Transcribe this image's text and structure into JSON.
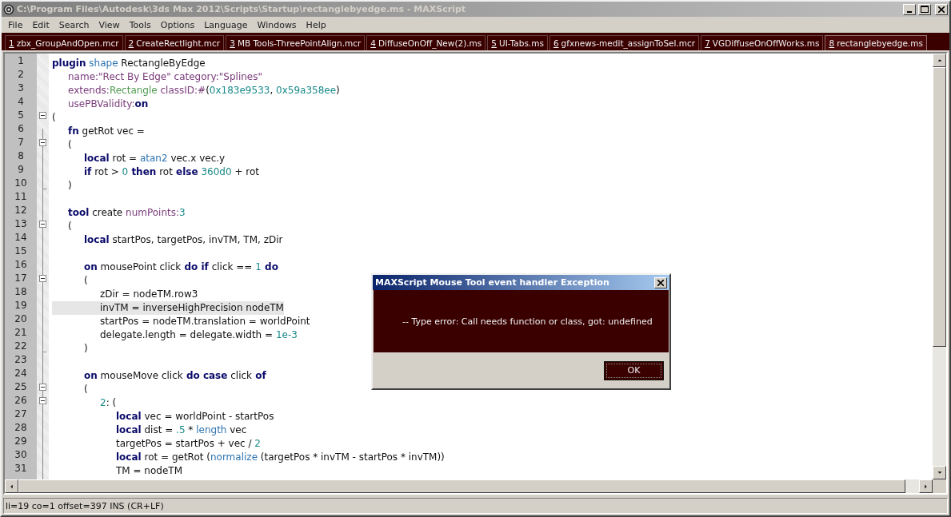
{
  "window": {
    "title": "C:\\Program Files\\Autodesk\\3ds Max 2012\\Scripts\\Startup\\rectanglebyedge.ms - MAXScript"
  },
  "menu": [
    "File",
    "Edit",
    "Search",
    "View",
    "Tools",
    "Options",
    "Language",
    "Windows",
    "Help"
  ],
  "tabs": [
    {
      "number": "1",
      "label": "zbx_GroupAndOpen.mcr",
      "selected": false
    },
    {
      "number": "2",
      "label": "CreateRectlight.mcr",
      "selected": false
    },
    {
      "number": "3",
      "label": "MB Tools-ThreePointAlign.mcr",
      "selected": false
    },
    {
      "number": "4",
      "label": "DiffuseOnOff_New(2).ms",
      "selected": false
    },
    {
      "number": "5",
      "label": "UI-Tabs.ms",
      "selected": false
    },
    {
      "number": "6",
      "label": "gfxnews-medit_assignToSel.mcr",
      "selected": false
    },
    {
      "number": "7",
      "label": "VGDiffuseOnOffWorks.ms",
      "selected": false
    },
    {
      "number": "8",
      "label": "rectanglebyedge.ms",
      "selected": true
    }
  ],
  "editor": {
    "lines": [
      {
        "number": "1",
        "tokens": [
          {
            "kind": "keyword",
            "text": "plugin"
          },
          {
            "kind": "function",
            "text": " shape"
          },
          {
            "kind": "plain",
            "text": " RectangleByEdge"
          }
        ]
      },
      {
        "number": "2",
        "tokens": [
          {
            "kind": "param",
            "text": "\tname:"
          },
          {
            "kind": "string",
            "text": "\"Rect By Edge\""
          },
          {
            "kind": "param",
            "text": " category:"
          },
          {
            "kind": "string",
            "text": "\"Splines\""
          }
        ]
      },
      {
        "number": "3",
        "tokens": [
          {
            "kind": "param",
            "text": "\textends:"
          },
          {
            "kind": "class",
            "text": "Rectangle"
          },
          {
            "kind": "param",
            "text": " classID:#"
          },
          {
            "kind": "plain",
            "text": "("
          },
          {
            "kind": "number",
            "text": "0x183e9533"
          },
          {
            "kind": "plain",
            "text": ","
          },
          {
            "kind": "number",
            "text": " 0x59a358ee"
          },
          {
            "kind": "plain",
            "text": ")"
          }
        ]
      },
      {
        "number": "4",
        "tokens": [
          {
            "kind": "param",
            "text": "\tusePBValidity:"
          },
          {
            "kind": "keyword",
            "text": "on"
          }
        ]
      },
      {
        "number": "5",
        "fold_open": true,
        "tokens": [
          {
            "kind": "plain",
            "text": "("
          }
        ]
      },
      {
        "number": "6",
        "tokens": [
          {
            "kind": "keyword",
            "text": "\tfn"
          },
          {
            "kind": "plain",
            "text": " getRot vec ="
          }
        ]
      },
      {
        "number": "7",
        "fold_open": true,
        "tokens": [
          {
            "kind": "plain",
            "text": "\t("
          }
        ]
      },
      {
        "number": "8",
        "tokens": [
          {
            "kind": "keyword",
            "text": "\t\tlocal"
          },
          {
            "kind": "plain",
            "text": " rot ="
          },
          {
            "kind": "function",
            "text": " atan2"
          },
          {
            "kind": "plain",
            "text": " vec.x vec.y"
          }
        ]
      },
      {
        "number": "9",
        "tokens": [
          {
            "kind": "keyword",
            "text": "\t\tif"
          },
          {
            "kind": "plain",
            "text": " rot >"
          },
          {
            "kind": "number",
            "text": " 0"
          },
          {
            "kind": "keyword",
            "text": " then"
          },
          {
            "kind": "plain",
            "text": " rot"
          },
          {
            "kind": "keyword",
            "text": " else"
          },
          {
            "kind": "number",
            "text": " 360d0"
          },
          {
            "kind": "plain",
            "text": " + rot"
          }
        ]
      },
      {
        "number": "10",
        "fold_end": true,
        "tokens": [
          {
            "kind": "plain",
            "text": "\t)"
          }
        ]
      },
      {
        "number": "11"
      },
      {
        "number": "12",
        "tokens": [
          {
            "kind": "keyword",
            "text": "\ttool"
          },
          {
            "kind": "plain",
            "text": " create"
          },
          {
            "kind": "param",
            "text": " numPoints:"
          },
          {
            "kind": "number",
            "text": "3"
          }
        ]
      },
      {
        "number": "13",
        "fold_open": true,
        "tokens": [
          {
            "kind": "plain",
            "text": "\t("
          }
        ]
      },
      {
        "number": "14",
        "tokens": [
          {
            "kind": "keyword",
            "text": "\t\tlocal"
          },
          {
            "kind": "plain",
            "text": " startPos, targetPos, invTM, TM, zDir"
          }
        ]
      },
      {
        "number": "15"
      },
      {
        "number": "16",
        "tokens": [
          {
            "kind": "keyword",
            "text": "\t\ton"
          },
          {
            "kind": "plain",
            "text": " mousePoint click"
          },
          {
            "kind": "keyword",
            "text": " do if"
          },
          {
            "kind": "plain",
            "text": " click =="
          },
          {
            "kind": "number",
            "text": " 1"
          },
          {
            "kind": "keyword",
            "text": " do"
          }
        ]
      },
      {
        "number": "17",
        "fold_open": true,
        "tokens": [
          {
            "kind": "plain",
            "text": "\t\t("
          }
        ]
      },
      {
        "number": "18",
        "tokens": [
          {
            "kind": "plain",
            "text": "\t\t\tzDir = nodeTM.row3"
          }
        ]
      },
      {
        "number": "19",
        "current": true,
        "tokens": [
          {
            "kind": "plain",
            "text": "\t\t\tinvTM = inverseHighPrecision nodeTM"
          }
        ]
      },
      {
        "number": "20",
        "tokens": [
          {
            "kind": "plain",
            "text": "\t\t\tstartPos = nodeTM.translation = worldPoint"
          }
        ]
      },
      {
        "number": "21",
        "tokens": [
          {
            "kind": "plain",
            "text": "\t\t\tdelegate.length = delegate.width ="
          },
          {
            "kind": "number",
            "text": " 1e-3"
          }
        ]
      },
      {
        "number": "22",
        "fold_end": true,
        "tokens": [
          {
            "kind": "plain",
            "text": "\t\t)"
          }
        ]
      },
      {
        "number": "23"
      },
      {
        "number": "24",
        "tokens": [
          {
            "kind": "keyword",
            "text": "\t\ton"
          },
          {
            "kind": "plain",
            "text": " mouseMove click"
          },
          {
            "kind": "keyword",
            "text": " do case"
          },
          {
            "kind": "plain",
            "text": " click"
          },
          {
            "kind": "keyword",
            "text": " of"
          }
        ]
      },
      {
        "number": "25",
        "fold_open": true,
        "tokens": [
          {
            "kind": "plain",
            "text": "\t\t("
          }
        ]
      },
      {
        "number": "26",
        "fold_open": true,
        "tokens": [
          {
            "kind": "number",
            "text": "\t\t\t2"
          },
          {
            "kind": "plain",
            "text": ": ("
          }
        ]
      },
      {
        "number": "27",
        "tokens": [
          {
            "kind": "keyword",
            "text": "\t\t\t\tlocal"
          },
          {
            "kind": "plain",
            "text": " vec = worldPoint - startPos"
          }
        ]
      },
      {
        "number": "28",
        "tokens": [
          {
            "kind": "keyword",
            "text": "\t\t\t\tlocal"
          },
          {
            "kind": "plain",
            "text": " dist ="
          },
          {
            "kind": "number",
            "text": " .5"
          },
          {
            "kind": "plain",
            "text": " *"
          },
          {
            "kind": "function",
            "text": " length"
          },
          {
            "kind": "plain",
            "text": " vec"
          }
        ]
      },
      {
        "number": "29",
        "tokens": [
          {
            "kind": "plain",
            "text": "\t\t\t\ttargetPos = startPos + vec /"
          },
          {
            "kind": "number",
            "text": " 2"
          }
        ]
      },
      {
        "number": "30",
        "tokens": [
          {
            "kind": "keyword",
            "text": "\t\t\t\tlocal"
          },
          {
            "kind": "plain",
            "text": " rot = getRot ("
          },
          {
            "kind": "function",
            "text": "normalize"
          },
          {
            "kind": "plain",
            "text": " (targetPos * invTM - startPos * invTM))"
          }
        ]
      },
      {
        "number": "31",
        "tokens": [
          {
            "kind": "plain",
            "text": "\t\t\t\tTM = nodeTM"
          }
        ]
      }
    ]
  },
  "status_bar": "li=19 co=1 offset=397 INS (CR+LF)",
  "dialog": {
    "title": "MAXScript Mouse Tool event handler Exception",
    "message": "-- Type error: Call needs function or class, got: undefined",
    "buttons": [
      "OK"
    ]
  }
}
